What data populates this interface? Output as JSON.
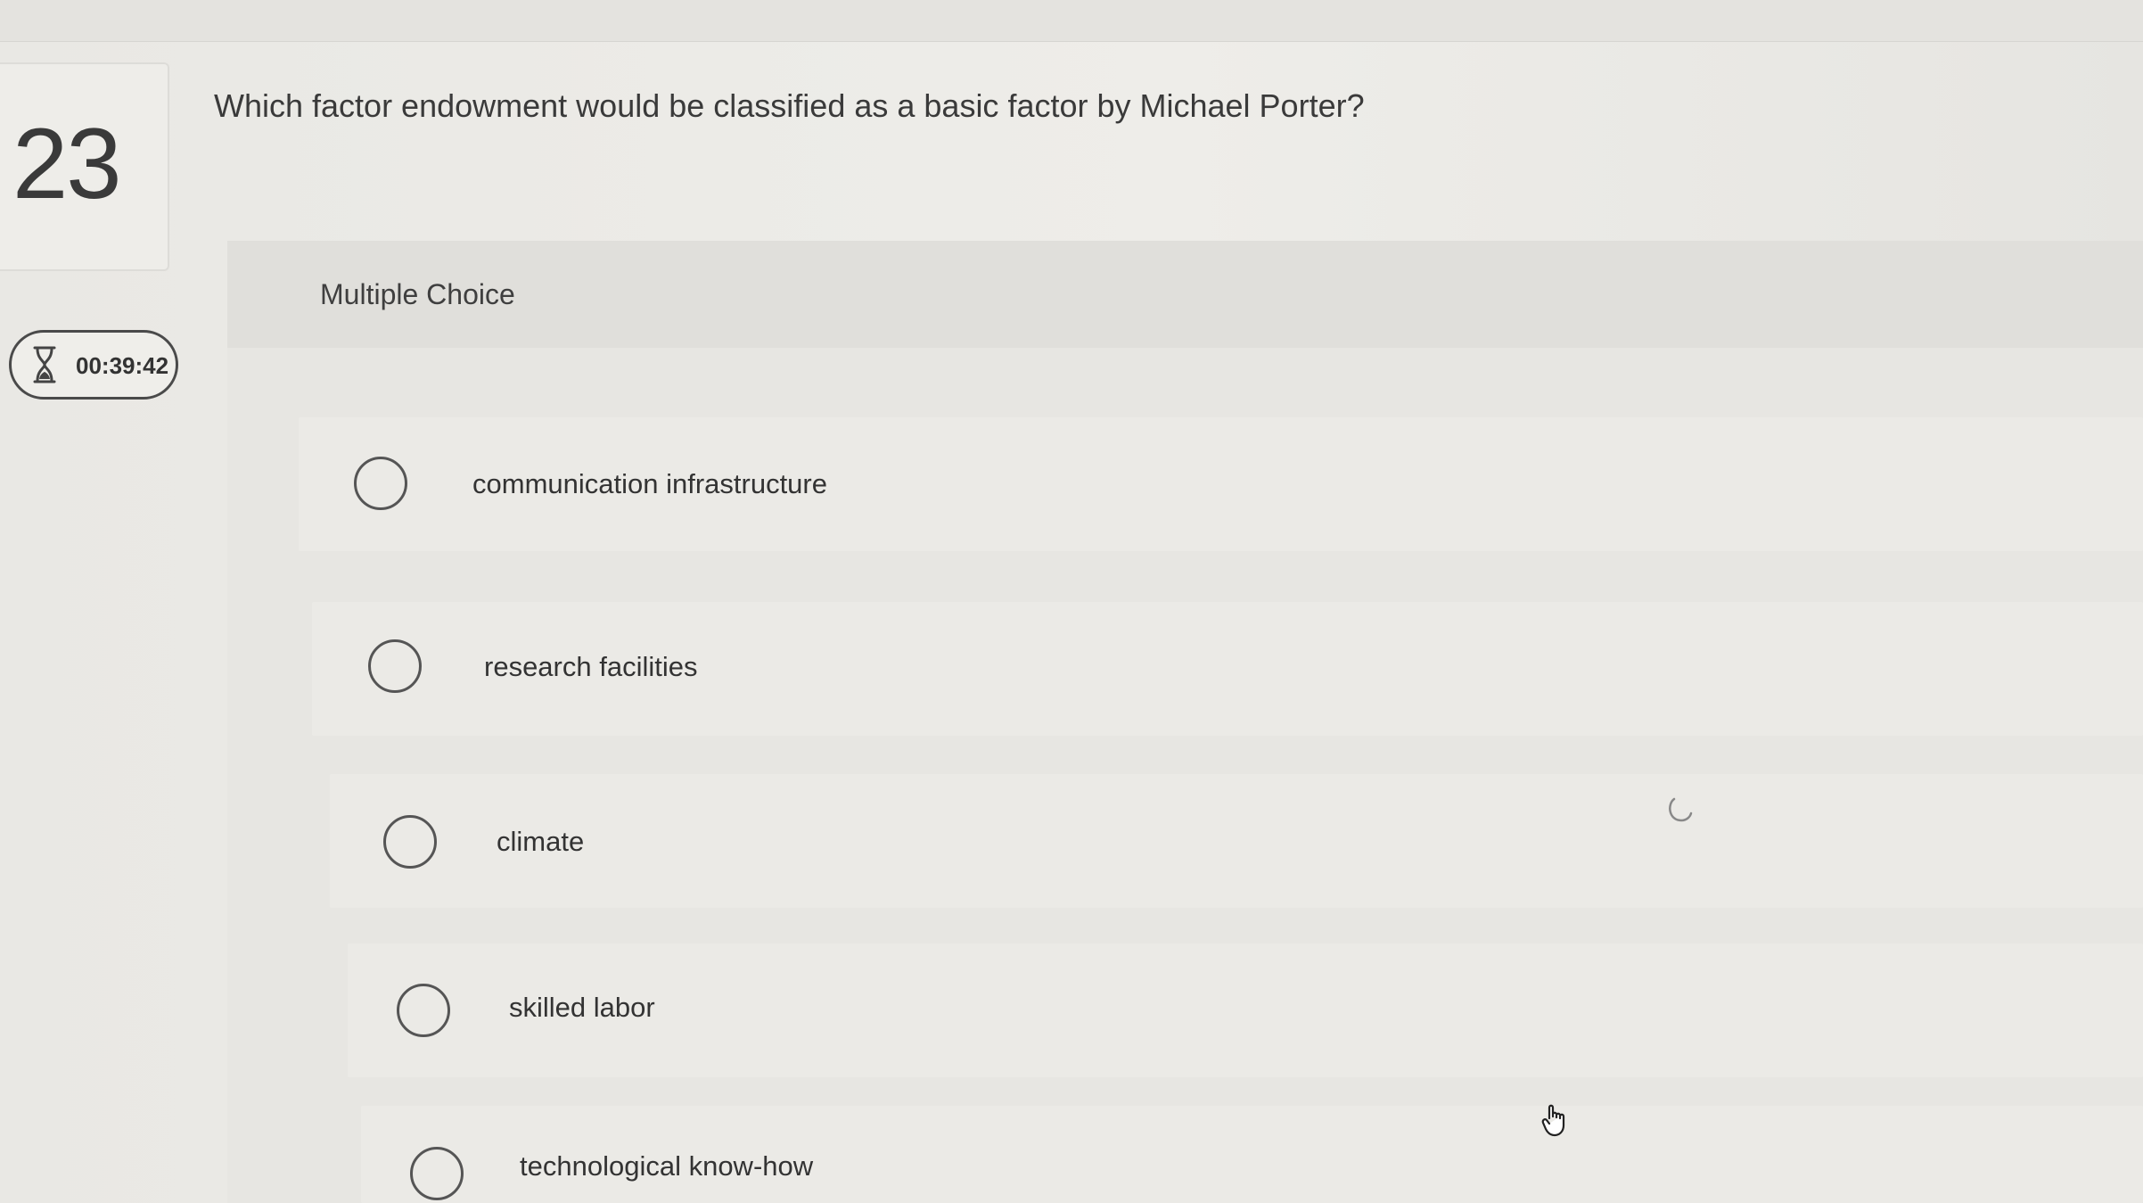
{
  "question": {
    "number": "23",
    "prompt": "Which factor endowment would be classified as a basic factor by Michael Porter?"
  },
  "timer": {
    "icon": "hourglass-icon",
    "value": "00:39:42"
  },
  "answer_section": {
    "type_label": "Multiple Choice",
    "options": [
      {
        "label": "communication infrastructure",
        "selected": false
      },
      {
        "label": "research facilities",
        "selected": false
      },
      {
        "label": "climate",
        "selected": false
      },
      {
        "label": "skilled labor",
        "selected": false
      },
      {
        "label": "technological know-how",
        "selected": false
      }
    ]
  },
  "colors": {
    "background": "#ecebe7",
    "header_band": "#e0dfdb",
    "text": "#333333",
    "radio_border": "#555555"
  }
}
